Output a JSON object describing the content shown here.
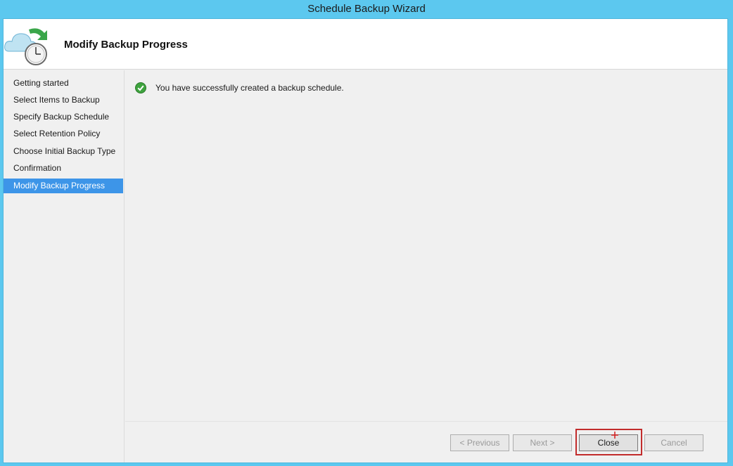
{
  "window": {
    "title": "Schedule Backup Wizard"
  },
  "header": {
    "title": "Modify Backup Progress",
    "icon": "cloud-clock-backup-icon"
  },
  "sidebar": {
    "items": [
      {
        "label": "Getting started",
        "active": false
      },
      {
        "label": "Select Items to Backup",
        "active": false
      },
      {
        "label": "Specify Backup Schedule",
        "active": false
      },
      {
        "label": "Select Retention Policy",
        "active": false
      },
      {
        "label": "Choose Initial Backup Type",
        "active": false
      },
      {
        "label": "Confirmation",
        "active": false
      },
      {
        "label": "Modify Backup Progress",
        "active": true
      }
    ]
  },
  "content": {
    "status_icon": "success-check-icon",
    "message": "You have successfully created a backup schedule."
  },
  "footer": {
    "previous_label": "< Previous",
    "next_label": "Next >",
    "close_label": "Close",
    "cancel_label": "Cancel"
  },
  "colors": {
    "titlebar": "#5cc8ef",
    "sidebar_active": "#3d95e8",
    "success_green": "#3ea33e",
    "highlight_red": "#c22c2c"
  }
}
